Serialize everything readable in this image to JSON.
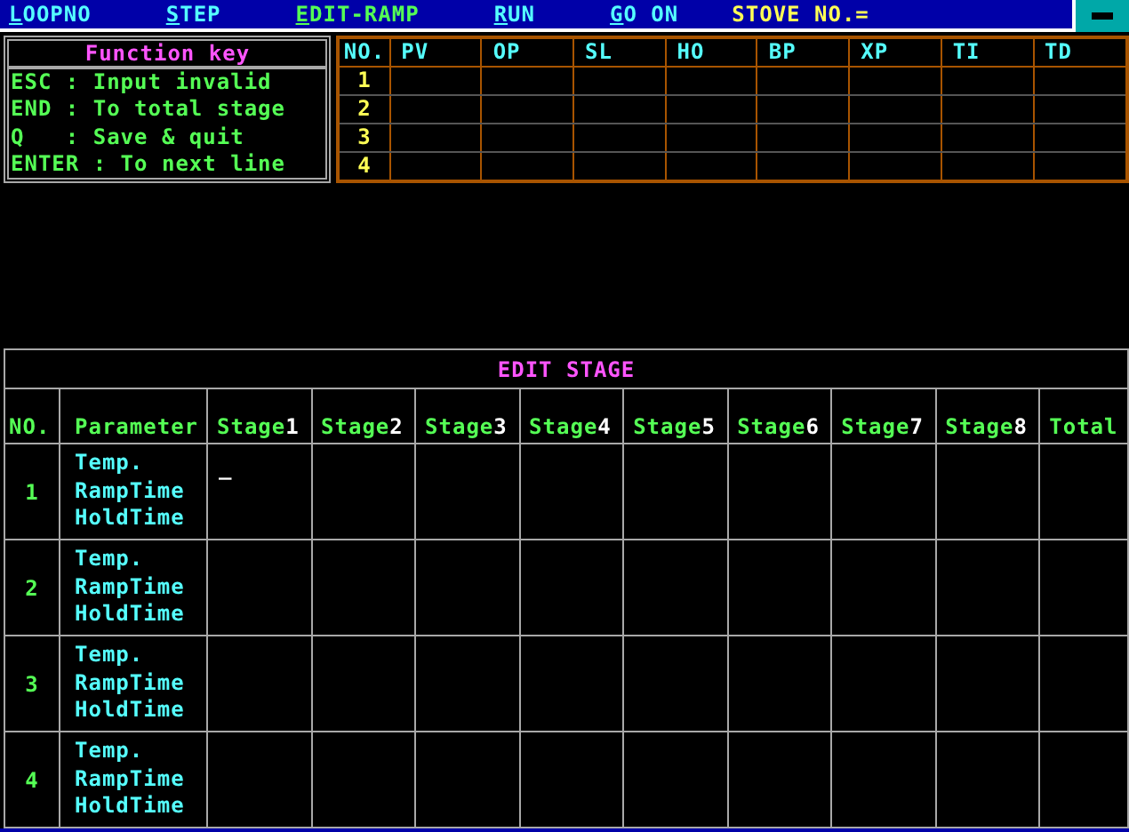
{
  "menu": [
    {
      "label": "LOOPNO",
      "selected": false
    },
    {
      "label": "STEP",
      "selected": false
    },
    {
      "label": "EDIT-RAMP",
      "selected": true
    },
    {
      "label": "RUN",
      "selected": false
    },
    {
      "label": "GO ON",
      "selected": false
    }
  ],
  "stove_label": "STOVE NO.=",
  "function_keys": {
    "title": "Function key",
    "lines": [
      "ESC : Input invalid",
      "END : To total stage",
      "Q   : Save & quit",
      "ENTER : To next line"
    ]
  },
  "pid_table": {
    "columns": [
      "NO.",
      "PV",
      "OP",
      "SL",
      "HO",
      "BP",
      "XP",
      "TI",
      "TD"
    ],
    "rows": [
      "1",
      "2",
      "3",
      "4"
    ]
  },
  "stage_table": {
    "title": "EDIT STAGE",
    "columns": [
      {
        "label": "NO."
      },
      {
        "label": "Parameter"
      },
      {
        "label": "Stage",
        "number": "1"
      },
      {
        "label": "Stage",
        "number": "2"
      },
      {
        "label": "Stage",
        "number": "3"
      },
      {
        "label": "Stage",
        "number": "4"
      },
      {
        "label": "Stage",
        "number": "5"
      },
      {
        "label": "Stage",
        "number": "6"
      },
      {
        "label": "Stage",
        "number": "7"
      },
      {
        "label": "Stage",
        "number": "8"
      },
      {
        "label": "Total"
      }
    ],
    "cursor": "_",
    "rows": [
      {
        "no": "1",
        "parameters": [
          "Temp.",
          "RampTime",
          "HoldTime"
        ]
      },
      {
        "no": "2",
        "parameters": [
          "Temp.",
          "RampTime",
          "HoldTime"
        ]
      },
      {
        "no": "3",
        "parameters": [
          "Temp.",
          "RampTime",
          "HoldTime"
        ]
      },
      {
        "no": "4",
        "parameters": [
          "Temp.",
          "RampTime",
          "HoldTime"
        ]
      }
    ]
  }
}
